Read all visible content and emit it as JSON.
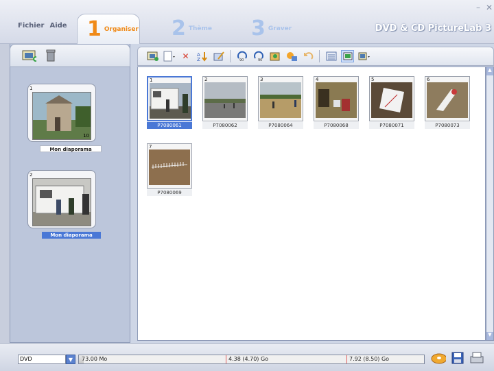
{
  "window": {
    "title": "DVD & CD PictureLab 3",
    "minimize": "–",
    "close": "✕"
  },
  "menu": {
    "file": "Fichier",
    "help": "Aide"
  },
  "steps": [
    {
      "num": "1",
      "label": "Organiser",
      "active": true
    },
    {
      "num": "2",
      "label": "Thème",
      "active": false
    },
    {
      "num": "3",
      "label": "Graver",
      "active": false
    }
  ],
  "slideshows": [
    {
      "number": "1",
      "count": "10",
      "label": "Mon diaporama",
      "selected": false
    },
    {
      "number": "2",
      "count": "",
      "label": "Mon diaporama",
      "selected": true
    }
  ],
  "photos": [
    {
      "number": "1",
      "name": "P7080061",
      "selected": true
    },
    {
      "number": "2",
      "name": "P7080062",
      "selected": false
    },
    {
      "number": "3",
      "name": "P7080064",
      "selected": false
    },
    {
      "number": "4",
      "name": "P7080068",
      "selected": false
    },
    {
      "number": "5",
      "name": "P7080071",
      "selected": false
    },
    {
      "number": "6",
      "name": "P7080073",
      "selected": false
    },
    {
      "number": "7",
      "name": "P7080069",
      "selected": false
    }
  ],
  "status": {
    "media": "DVD",
    "used": "73.00 Mo",
    "capacity_mid": "4.38 (4.70) Go",
    "capacity_max": "7.92 (8.50) Go",
    "used_fraction": 0.014
  },
  "colors": {
    "accent": "#f08a18",
    "selection": "#4a78d6"
  }
}
